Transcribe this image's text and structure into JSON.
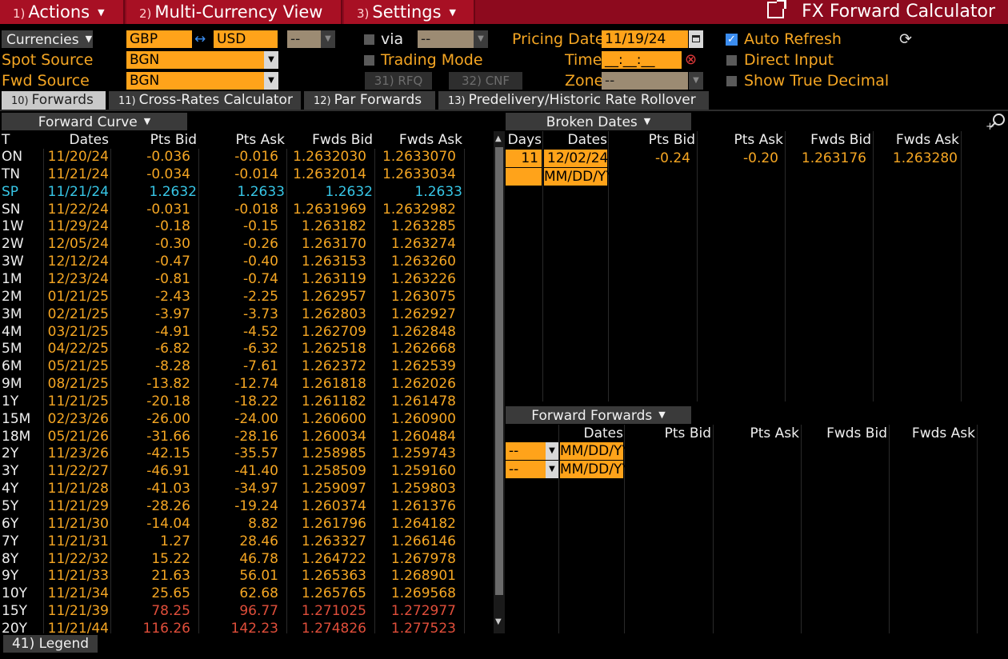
{
  "menu": {
    "actions": {
      "num": "1)",
      "label": "Actions"
    },
    "multi": {
      "num": "2)",
      "label": "Multi-Currency View"
    },
    "settings": {
      "num": "3)",
      "label": "Settings"
    },
    "title": "FX Forward Calculator"
  },
  "form": {
    "currencies_label": "Currencies",
    "ccy1": "GBP",
    "swap_glyph": "↔",
    "ccy2": "USD",
    "extra": "--",
    "via_label": "via",
    "via_value": "--",
    "spot_source_label": "Spot Source",
    "spot_source": "BGN",
    "fwd_source_label": "Fwd Source",
    "fwd_source": "BGN",
    "trading_mode_label": "Trading Mode",
    "rfq_btn": "31) RFQ",
    "cnf_btn": "32) CNF",
    "pricing_date_label": "Pricing Date",
    "pricing_date": "11/19/24",
    "time_label": "Time",
    "time_value": "__:__:__",
    "zone_label": "Zone",
    "zone_value": "--",
    "auto_refresh": "Auto Refresh",
    "direct_input": "Direct Input",
    "show_true_decimal": "Show True Decimal"
  },
  "tabs": [
    {
      "num": "10)",
      "label": "Forwards"
    },
    {
      "num": "11)",
      "label": "Cross-Rates Calculator"
    },
    {
      "num": "12)",
      "label": "Par Forwards"
    },
    {
      "num": "13)",
      "label": "Predelivery/Historic Rate Rollover"
    }
  ],
  "forward_curve": {
    "title": "Forward Curve",
    "headers": [
      "T",
      "Dates",
      "Pts Bid",
      "Pts Ask",
      "Fwds Bid",
      "Fwds Ask"
    ],
    "rows": [
      [
        "ON",
        "11/20/24",
        "-0.036",
        "-0.016",
        "1.2632030",
        "1.2633070"
      ],
      [
        "TN",
        "11/21/24",
        "-0.034",
        "-0.014",
        "1.2632014",
        "1.2633034"
      ],
      [
        "SP",
        "11/21/24",
        "1.2632",
        "1.2633",
        "1.2632",
        "1.2633"
      ],
      [
        "SN",
        "11/22/24",
        "-0.031",
        "-0.018",
        "1.2631969",
        "1.2632982"
      ],
      [
        "1W",
        "11/29/24",
        "-0.18",
        "-0.15",
        "1.263182",
        "1.263285"
      ],
      [
        "2W",
        "12/05/24",
        "-0.30",
        "-0.26",
        "1.263170",
        "1.263274"
      ],
      [
        "3W",
        "12/12/24",
        "-0.47",
        "-0.40",
        "1.263153",
        "1.263260"
      ],
      [
        "1M",
        "12/23/24",
        "-0.81",
        "-0.74",
        "1.263119",
        "1.263226"
      ],
      [
        "2M",
        "01/21/25",
        "-2.43",
        "-2.25",
        "1.262957",
        "1.263075"
      ],
      [
        "3M",
        "02/21/25",
        "-3.97",
        "-3.73",
        "1.262803",
        "1.262927"
      ],
      [
        "4M",
        "03/21/25",
        "-4.91",
        "-4.52",
        "1.262709",
        "1.262848"
      ],
      [
        "5M",
        "04/22/25",
        "-6.82",
        "-6.32",
        "1.262518",
        "1.262668"
      ],
      [
        "6M",
        "05/21/25",
        "-8.28",
        "-7.61",
        "1.262372",
        "1.262539"
      ],
      [
        "9M",
        "08/21/25",
        "-13.82",
        "-12.74",
        "1.261818",
        "1.262026"
      ],
      [
        "1Y",
        "11/21/25",
        "-20.18",
        "-18.22",
        "1.261182",
        "1.261478"
      ],
      [
        "15M",
        "02/23/26",
        "-26.00",
        "-24.00",
        "1.260600",
        "1.260900"
      ],
      [
        "18M",
        "05/21/26",
        "-31.66",
        "-28.16",
        "1.260034",
        "1.260484"
      ],
      [
        "2Y",
        "11/23/26",
        "-42.15",
        "-35.57",
        "1.258985",
        "1.259743"
      ],
      [
        "3Y",
        "11/22/27",
        "-46.91",
        "-41.40",
        "1.258509",
        "1.259160"
      ],
      [
        "4Y",
        "11/21/28",
        "-41.03",
        "-34.97",
        "1.259097",
        "1.259803"
      ],
      [
        "5Y",
        "11/21/29",
        "-28.26",
        "-19.24",
        "1.260374",
        "1.261376"
      ],
      [
        "6Y",
        "11/21/30",
        "-14.04",
        "8.82",
        "1.261796",
        "1.264182"
      ],
      [
        "7Y",
        "11/21/31",
        "1.27",
        "28.46",
        "1.263327",
        "1.266146"
      ],
      [
        "8Y",
        "11/22/32",
        "15.22",
        "46.78",
        "1.264722",
        "1.267978"
      ],
      [
        "9Y",
        "11/21/33",
        "21.63",
        "56.01",
        "1.265363",
        "1.268901"
      ],
      [
        "10Y",
        "11/21/34",
        "25.65",
        "62.68",
        "1.265765",
        "1.269568"
      ],
      [
        "15Y",
        "11/21/39",
        "78.25",
        "96.77",
        "1.271025",
        "1.272977"
      ],
      [
        "20Y",
        "11/21/44",
        "116.26",
        "142.23",
        "1.274826",
        "1.277523"
      ]
    ]
  },
  "broken_dates": {
    "title": "Broken Dates",
    "headers": [
      "Days",
      "Dates",
      "Pts Bid",
      "Pts Ask",
      "Fwds Bid",
      "Fwds Ask"
    ],
    "row1": [
      "11",
      "12/02/24",
      "-0.24",
      "-0.20",
      "1.263176",
      "1.263280"
    ],
    "placeholder": "MM/DD/YY"
  },
  "forward_forwards": {
    "title": "Forward Forwards",
    "headers": [
      "Dates",
      "Pts Bid",
      "Pts Ask",
      "Fwds Bid",
      "Fwds Ask"
    ],
    "sel": "--",
    "placeholder": "MM/DD/YY"
  },
  "legend": "41) Legend"
}
